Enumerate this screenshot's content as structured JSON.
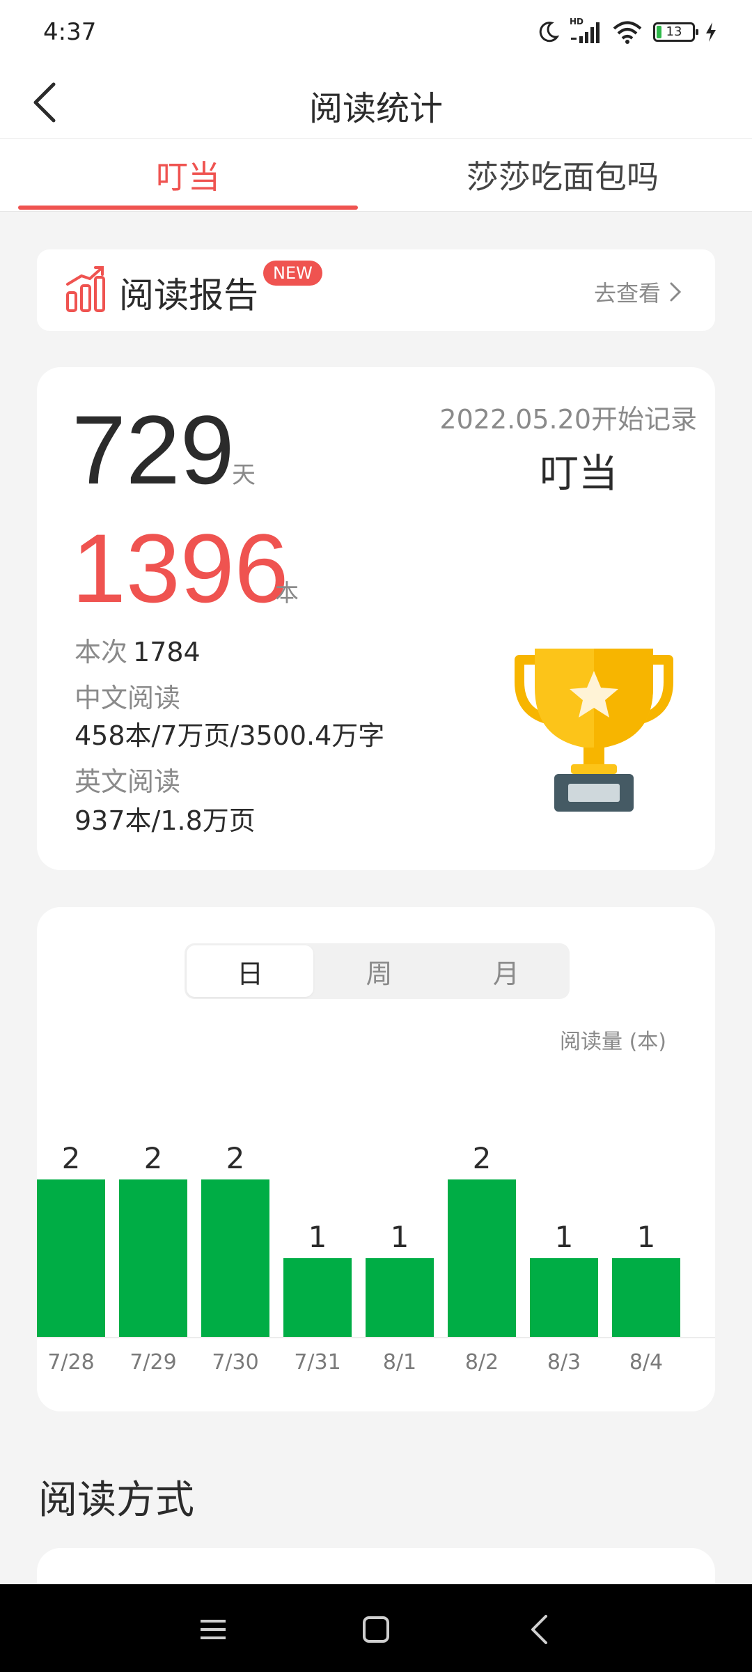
{
  "status_bar": {
    "time": "4:37",
    "battery": "13",
    "network": "HD"
  },
  "header": {
    "title": "阅读统计"
  },
  "tabs": [
    {
      "label": "叮当",
      "active": true
    },
    {
      "label": "莎莎吃面包吗",
      "active": false
    }
  ],
  "report": {
    "title": "阅读报告",
    "badge": "NEW",
    "link": "去查看"
  },
  "stats": {
    "days": "729",
    "days_unit": "天",
    "since": "2022.05.20开始记录",
    "name": "叮当",
    "books": "1396",
    "books_unit": "本",
    "session_label": "本次",
    "session_value": "1784",
    "cn_label": "中文阅读",
    "cn_value": "458本/7万页/3500.4万字",
    "en_label": "英文阅读",
    "en_value": "937本/1.8万页"
  },
  "period_toggle": [
    "日",
    "周",
    "月"
  ],
  "chart_data": {
    "type": "bar",
    "ylabel": "阅读量 (本)",
    "categories": [
      "7/28",
      "7/29",
      "7/30",
      "7/31",
      "8/1",
      "8/2",
      "8/3",
      "8/4"
    ],
    "values": [
      2,
      2,
      2,
      1,
      1,
      2,
      1,
      1
    ],
    "ylim": [
      0,
      2
    ],
    "color": "#00ad45"
  },
  "section": {
    "reading_mode_title": "阅读方式"
  },
  "colors": {
    "accent": "#ef5350",
    "bar": "#00ad45",
    "background": "#f4f4f4"
  }
}
